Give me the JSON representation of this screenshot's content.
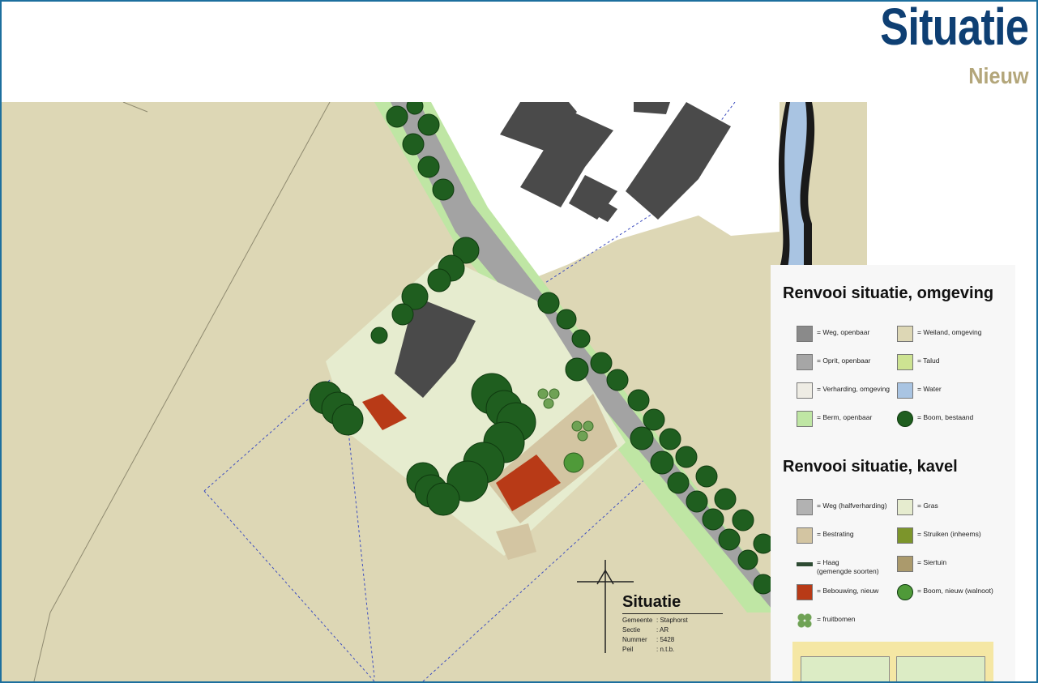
{
  "header": {
    "title": "Situatie",
    "subtitle": "Nieuw"
  },
  "legend": {
    "omgeving": {
      "title": "Renvooi situatie, omgeving",
      "items": [
        {
          "label": "= Weg, openbaar",
          "color": "#8a8a8a",
          "icon": "road-public-swatch"
        },
        {
          "label": "= Weiland, omgeving",
          "color": "#ddd7b5",
          "icon": "meadow-swatch"
        },
        {
          "label": "= Oprit, openbaar",
          "color": "#a6a6a6",
          "icon": "driveway-public-swatch"
        },
        {
          "label": "= Talud",
          "color": "#cde392",
          "icon": "slope-swatch"
        },
        {
          "label": "= Verharding, omgeving",
          "color": "#eeece4",
          "icon": "paving-area-swatch"
        },
        {
          "label": "= Water",
          "color": "#a9c4e2",
          "icon": "water-swatch"
        },
        {
          "label": "= Berm, openbaar",
          "color": "#bfe6a4",
          "icon": "verge-swatch"
        },
        {
          "label": "= Boom, bestaand",
          "color": "#1f5e1f",
          "icon": "existing-tree-icon"
        }
      ]
    },
    "kavel": {
      "title": "Renvooi situatie, kavel",
      "items": [
        {
          "label": "= Weg (halfverharding)",
          "color": "#b2b2b2",
          "icon": "semi-paved-road-swatch"
        },
        {
          "label": "= Gras",
          "color": "#e6eccf",
          "icon": "grass-swatch"
        },
        {
          "label": "= Bestrating",
          "color": "#d3c5a2",
          "icon": "pavement-swatch"
        },
        {
          "label": "= Struiken (inheems)",
          "color": "#7c952b",
          "icon": "shrubs-swatch"
        },
        {
          "label": "= Haag\n(gemengde soorten)",
          "color": "#2e4b33",
          "icon": "hedge-swatch"
        },
        {
          "label": "= Siertuin",
          "color": "#ab9a6c",
          "icon": "ornamental-garden-swatch"
        },
        {
          "label": "= Bebouwing, nieuw",
          "color": "#b83a17",
          "icon": "new-building-swatch"
        },
        {
          "label": "=  Boom, nieuw (walnoot)",
          "color": "#4f9a39",
          "icon": "new-walnut-tree-icon"
        },
        {
          "label": "= fruitbomen",
          "color": "#6fa255",
          "icon": "fruit-trees-icon"
        }
      ]
    }
  },
  "site_info": {
    "title": "Situatie",
    "rows": [
      {
        "key": "Gemeente",
        "value": ": Staphorst"
      },
      {
        "key": "Sectie",
        "value": ": AR"
      },
      {
        "key": "Nummer",
        "value": ": 5428"
      },
      {
        "key": "Peil",
        "value": ": n.t.b."
      }
    ]
  },
  "colors": {
    "title": "#0e3f73",
    "subtitle": "#b3a67a",
    "frame": "#1d6f9e",
    "meadow": "#ddd7b5",
    "road": "#a3a3a3",
    "verge": "#bfe6a4",
    "water": "#a9c4e2",
    "tree": "#1f5e1f",
    "building_new": "#b83a17",
    "building_existing": "#4a4a4a",
    "grass": "#e6eccf"
  }
}
